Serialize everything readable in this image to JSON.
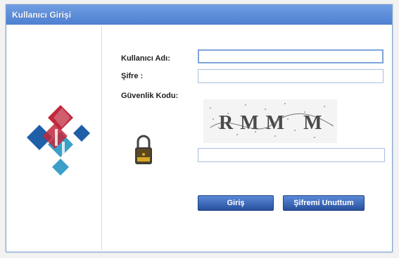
{
  "window": {
    "title": "Kullanıcı Girişi"
  },
  "form": {
    "username_label": "Kullanıcı Adı:",
    "username_value": "",
    "password_label": "Şifre :",
    "password_value": "",
    "security_code_label": "Güvenlik Kodu:",
    "captcha_text": "RMM M",
    "security_code_value": ""
  },
  "buttons": {
    "login_label": "Giriş",
    "forgot_label": "Şifremi Unuttum"
  },
  "colors": {
    "titlebar": "#5a8ad8",
    "logo_red": "#c0283c",
    "logo_blue": "#1f5fa8",
    "logo_teal": "#3aa0c8",
    "button": "#2f5aa8"
  },
  "icons": [
    "logo-icon",
    "padlock-icon"
  ]
}
